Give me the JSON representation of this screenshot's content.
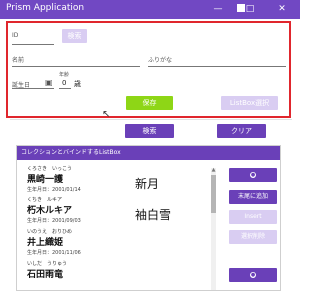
{
  "window": {
    "title": "Prism Application",
    "minimize_glyph": "—",
    "restore_glyph": "□",
    "close_glyph": "✕"
  },
  "form": {
    "id_label": "ID",
    "id_value": "",
    "search_button": "検索",
    "name_label": "名前",
    "name_value": "",
    "kana_label": "ふりがな",
    "kana_value": "",
    "birth_label": "誕生日",
    "birth_value": "",
    "age_caption": "年齢",
    "age_value": "0",
    "age_unit": "歳",
    "calendar_icon": "calendar-icon"
  },
  "actions": {
    "save_button": "保存",
    "listbox_select_button": "ListBox選択",
    "search_button": "検索",
    "clear_button": "クリア"
  },
  "list": {
    "header": "コレクションとバインドするListBox",
    "items": [
      {
        "kana": "くろさき　いっこう",
        "name": "黒崎一護",
        "birth": "生年月日：2001/01/14",
        "era": "新月"
      },
      {
        "kana": "くちき　ルキア",
        "name": "朽木ルキア",
        "birth": "生年月日：2001/09/03",
        "era": "袖白雪"
      },
      {
        "kana": "いのうえ　おりひめ",
        "name": "井上織姫",
        "birth": "生年月日：2001/11/06",
        "era": ""
      },
      {
        "kana": "いしだ　うりゅう",
        "name": "石田雨竜",
        "birth": "",
        "era": ""
      }
    ]
  },
  "side_buttons": {
    "top_circle": "●",
    "append_end": "末尾に追加",
    "insert": "Insert",
    "delete_selected": "選択削除",
    "bottom_circle": "●"
  },
  "colors": {
    "accent": "#6a40b8",
    "save": "#8ed616",
    "highlight": "#e0262d"
  }
}
